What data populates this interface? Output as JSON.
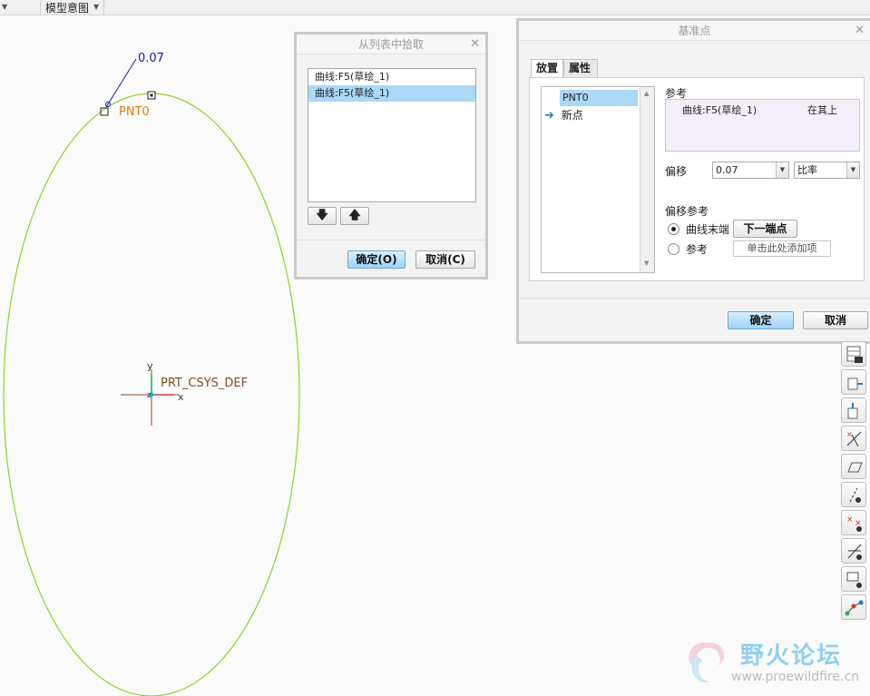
{
  "topbar": {
    "view_label": "模型意图"
  },
  "canvas": {
    "offset_value": "0.07",
    "point_label": "PNT0",
    "csys_label": "PRT_CSYS_DEF",
    "axis_y": "y",
    "axis_x": "x",
    "axis_z": "z"
  },
  "pick_dialog": {
    "title": "从列表中拾取",
    "items": [
      "曲线:F5(草绘_1)",
      "曲线:F5(草绘_1)"
    ],
    "selected_index": 1,
    "ok_label": "确定(O)",
    "cancel_label": "取消(C)"
  },
  "datum_dialog": {
    "title": "基准点",
    "tabs": [
      "放置",
      "属性"
    ],
    "points": [
      "PNT0",
      "新点"
    ],
    "ref_label": "参考",
    "ref_curve": "曲线:F5(草绘_1)",
    "ref_constraint": "在其上",
    "offset_label": "偏移",
    "offset_value": "0.07",
    "offset_type": "比率",
    "offset_ref_label": "偏移参考",
    "opt_curve_end": "曲线末端",
    "next_end_button": "下一端点",
    "opt_reference": "参考",
    "add_item_placeholder": "单击此处添加项",
    "ok_label": "确定",
    "cancel_label": "取消"
  },
  "watermark": {
    "text_cn": "野火论坛",
    "url": "www.proewildfire.cn"
  },
  "colors": {
    "curve": "#8fd12b",
    "selection": "#aad8f7",
    "point_label": "#e07a10",
    "primary_button": "#9fd3f5"
  }
}
